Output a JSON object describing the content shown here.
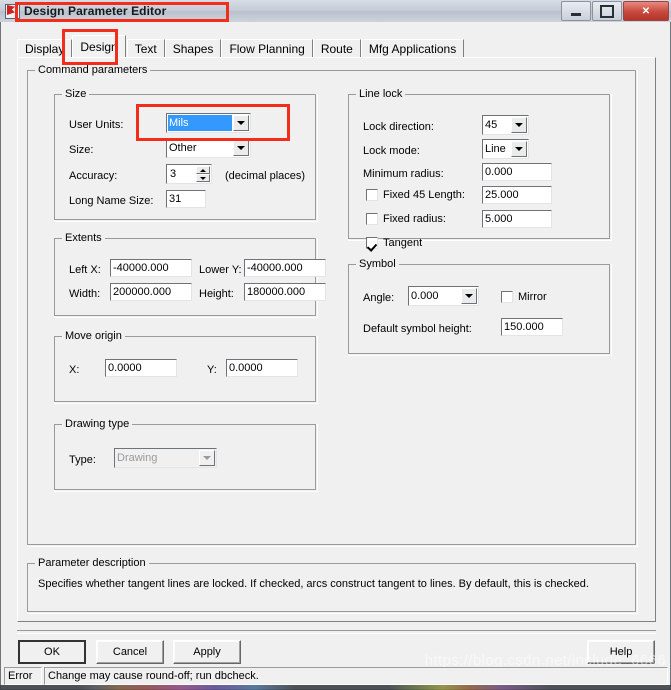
{
  "window": {
    "title": "Design Parameter Editor",
    "icon": "app-flag-icon",
    "minimize_label": "Minimize",
    "maximize_label": "Maximize",
    "close_label": "✕"
  },
  "tabs": [
    {
      "label": "Display",
      "active": false
    },
    {
      "label": "Design",
      "active": true
    },
    {
      "label": "Text",
      "active": false
    },
    {
      "label": "Shapes",
      "active": false
    },
    {
      "label": "Flow Planning",
      "active": false
    },
    {
      "label": "Route",
      "active": false
    },
    {
      "label": "Mfg Applications",
      "active": false
    }
  ],
  "command_parameters": {
    "label": "Command parameters",
    "size": {
      "label": "Size",
      "user_units_label": "User Units:",
      "user_units_value": "Mils",
      "size_label": "Size:",
      "size_value": "Other",
      "accuracy_label": "Accuracy:",
      "accuracy_value": "3",
      "accuracy_suffix": "(decimal places)",
      "long_name_size_label": "Long Name Size:",
      "long_name_size_value": "31"
    },
    "extents": {
      "label": "Extents",
      "left_x_label": "Left X:",
      "left_x_value": "-40000.000",
      "lower_y_label": "Lower Y:",
      "lower_y_value": "-40000.000",
      "width_label": "Width:",
      "width_value": "200000.000",
      "height_label": "Height:",
      "height_value": "180000.000"
    },
    "move_origin": {
      "label": "Move origin",
      "x_label": "X:",
      "x_value": "0.0000",
      "y_label": "Y:",
      "y_value": "0.0000"
    },
    "drawing_type": {
      "label": "Drawing type",
      "type_label": "Type:",
      "type_value": "Drawing"
    },
    "line_lock": {
      "label": "Line lock",
      "lock_direction_label": "Lock direction:",
      "lock_direction_value": "45",
      "lock_mode_label": "Lock mode:",
      "lock_mode_value": "Line",
      "minimum_radius_label": "Minimum radius:",
      "minimum_radius_value": "0.000",
      "fixed_45_length_label": "Fixed 45 Length:",
      "fixed_45_length_value": "25.000",
      "fixed_45_length_checked": false,
      "fixed_radius_label": "Fixed radius:",
      "fixed_radius_value": "5.000",
      "fixed_radius_checked": false,
      "tangent_label": "Tangent",
      "tangent_checked": true
    },
    "symbol": {
      "label": "Symbol",
      "angle_label": "Angle:",
      "angle_value": "0.000",
      "mirror_label": "Mirror",
      "mirror_checked": false,
      "default_symbol_height_label": "Default symbol height:",
      "default_symbol_height_value": "150.000"
    }
  },
  "parameter_description": {
    "label": "Parameter description",
    "text": "Specifies whether tangent lines are locked. If checked, arcs construct tangent to lines. By default, this is checked."
  },
  "buttons": {
    "ok": "OK",
    "cancel": "Cancel",
    "apply": "Apply",
    "help": "Help"
  },
  "statusbar": {
    "severity": "Error",
    "message": "Change may cause round-off; run dbcheck."
  },
  "watermark": "https://blog.csdn.net/include_6666",
  "colors": {
    "selection_blue": "#3399ff",
    "annotation_red": "#f22d1c",
    "dialog_face": "#f0f0f0",
    "close_button_red": "#c7483c"
  }
}
